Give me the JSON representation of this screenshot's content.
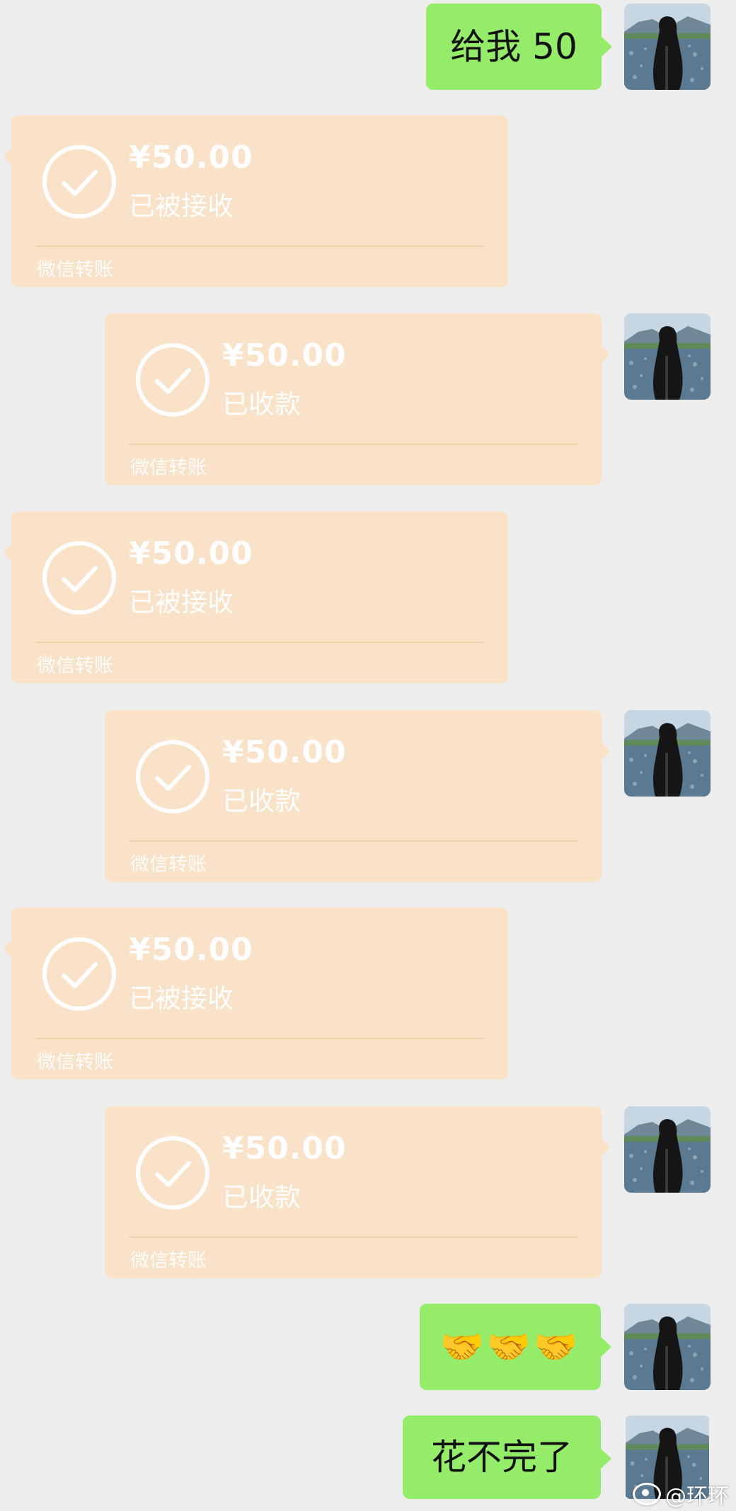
{
  "colors": {
    "background": "#ededed",
    "sent_bubble": "#95ec69",
    "transfer_card": "#f9e2c7"
  },
  "messages": [
    {
      "type": "text",
      "side": "right",
      "text": "给我 50"
    },
    {
      "type": "transfer",
      "side": "left",
      "amount": "¥50.00",
      "status": "已被接收",
      "label": "微信转账"
    },
    {
      "type": "transfer",
      "side": "right",
      "amount": "¥50.00",
      "status": "已收款",
      "label": "微信转账"
    },
    {
      "type": "transfer",
      "side": "left",
      "amount": "¥50.00",
      "status": "已被接收",
      "label": "微信转账"
    },
    {
      "type": "transfer",
      "side": "right",
      "amount": "¥50.00",
      "status": "已收款",
      "label": "微信转账"
    },
    {
      "type": "transfer",
      "side": "left",
      "amount": "¥50.00",
      "status": "已被接收",
      "label": "微信转账"
    },
    {
      "type": "transfer",
      "side": "right",
      "amount": "¥50.00",
      "status": "已收款",
      "label": "微信转账"
    },
    {
      "type": "text",
      "side": "right",
      "text": "🤝🤝🤝"
    },
    {
      "type": "text",
      "side": "right",
      "text": "花不完了"
    }
  ],
  "watermark": {
    "text": "@环环",
    "icon": "weibo-eye-icon"
  },
  "avatar_icon": "avatar-photo-icon",
  "check_icon": "check-circle-icon"
}
